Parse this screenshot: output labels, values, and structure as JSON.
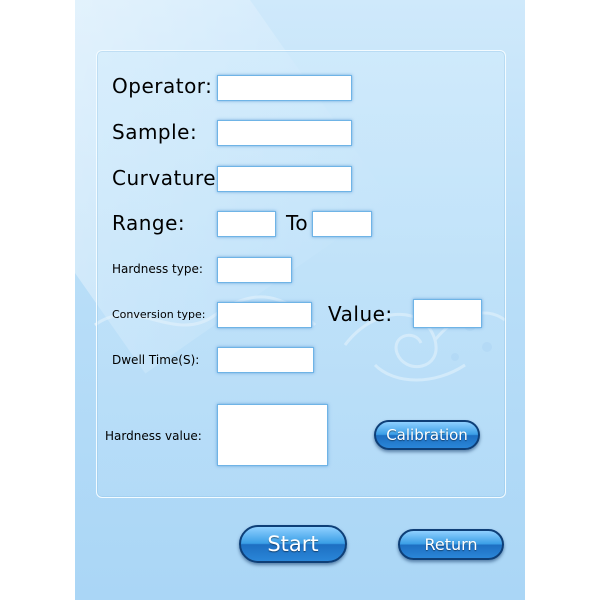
{
  "form": {
    "operator_label": "Operator:",
    "sample_label": "Sample:",
    "curvature_label": "Curvature:",
    "range_label": "Range:",
    "range_to_label": "To",
    "hardness_type_label": "Hardness type:",
    "conversion_type_label": "Conversion type:",
    "value_label": "Value:",
    "dwell_time_label": "Dwell Time(S):",
    "hardness_value_label": "Hardness value:",
    "operator_value": "",
    "sample_value": "",
    "curvature_value": "",
    "range_from_value": "",
    "range_to_value": "",
    "hardness_type_value": "",
    "conversion_type_value": "",
    "value_value": "",
    "dwell_time_value": "",
    "hardness_value_value": ""
  },
  "buttons": {
    "calibration_label": "Calibration",
    "start_label": "Start",
    "return_label": "Return"
  },
  "colors": {
    "background": "#b9def8",
    "button_dark": "#0e3f77",
    "button_light": "#3a9ee6",
    "field_border": "#6fb4e6"
  }
}
